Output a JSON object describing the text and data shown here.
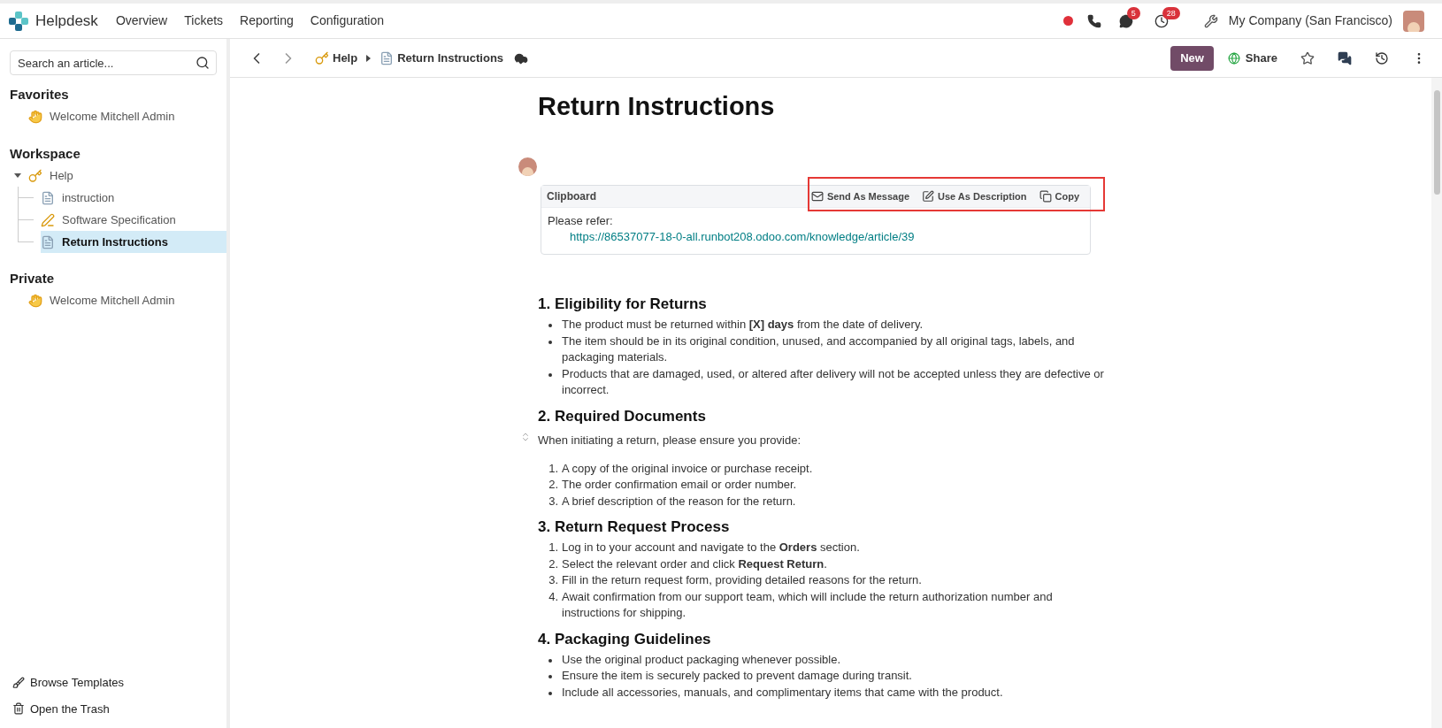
{
  "topbar": {
    "app_name": "Helpdesk",
    "menu": [
      "Overview",
      "Tickets",
      "Reporting",
      "Configuration"
    ],
    "chat_count": "5",
    "activity_count": "28",
    "company": "My Company (San Francisco)"
  },
  "sidebar": {
    "search": {
      "placeholder": "Search an article..."
    },
    "sections": [
      {
        "title": "Favorites",
        "items": [
          {
            "label": "Welcome Mitchell Admin",
            "kind": "wave",
            "selected": false
          }
        ]
      },
      {
        "title": "Workspace",
        "items": [
          {
            "label": "Help",
            "kind": "key",
            "selected": false,
            "expanded": true,
            "children": [
              {
                "label": "instruction",
                "kind": "page",
                "selected": false
              },
              {
                "label": "Software Specification",
                "kind": "writing",
                "selected": false
              },
              {
                "label": "Return Instructions",
                "kind": "page",
                "selected": true
              }
            ]
          }
        ]
      },
      {
        "title": "Private",
        "items": [
          {
            "label": "Welcome Mitchell Admin",
            "kind": "wave",
            "selected": false
          }
        ]
      }
    ],
    "footer": [
      {
        "label": "Browse Templates",
        "kind": "brush"
      },
      {
        "label": "Open the Trash",
        "kind": "trash"
      }
    ]
  },
  "toolbar": {
    "breadcrumb": [
      {
        "label": "Help",
        "kind": "key"
      },
      {
        "label": "Return Instructions",
        "kind": "page"
      }
    ],
    "new_button": "New",
    "share_button": "Share",
    "favorite": false
  },
  "article": {
    "title": "Return Instructions",
    "clipboard": {
      "title": "Clipboard",
      "highlighted": true,
      "actions": [
        {
          "label": "Send As Message",
          "kind": "message"
        },
        {
          "label": "Use As Description",
          "kind": "description"
        },
        {
          "label": "Copy",
          "kind": "copy"
        }
      ],
      "text": "Please refer:",
      "link": "https://86537077-18-0-all.runbot208.odoo.com/knowledge/article/39"
    },
    "sections": [
      {
        "heading": "1. Eligibility for Returns",
        "blocks": [
          {
            "kind": "bullets",
            "items": [
              {
                "text": "The product must be returned within **[X] days** from the date of delivery."
              },
              {
                "text": "The item should be in its original condition, unused, and accompanied by all original tags, labels, and packaging materials."
              },
              {
                "text": "Products that are damaged, used, or altered after delivery will not be accepted unless they are defective or incorrect."
              }
            ]
          }
        ]
      },
      {
        "heading": "2. Required Documents",
        "blocks": [
          {
            "kind": "paragraph",
            "text": "When initiating a return, please ensure you provide:"
          },
          {
            "kind": "numbered",
            "items": [
              {
                "number": "1.",
                "text": "A copy of the original invoice or purchase receipt."
              },
              {
                "number": "2.",
                "text": "The order confirmation email or order number."
              },
              {
                "number": "3.",
                "text": "A brief description of the reason for the return."
              }
            ]
          }
        ]
      },
      {
        "heading": "3. Return Request Process",
        "blocks": [
          {
            "kind": "numbered",
            "items": [
              {
                "number": "1.",
                "text": "Log in to your account and navigate to the **Orders** section."
              },
              {
                "number": "2.",
                "text": "Select the relevant order and click **Request Return**."
              },
              {
                "number": "3.",
                "text": "Fill in the return request form, providing detailed reasons for the return."
              },
              {
                "number": "4.",
                "text": "Await confirmation from our support team, which will include the return authorization number and instructions for shipping."
              }
            ]
          }
        ]
      },
      {
        "heading": "4. Packaging Guidelines",
        "blocks": [
          {
            "kind": "bullets",
            "items": [
              {
                "text": "Use the original product packaging whenever possible."
              },
              {
                "text": "Ensure the item is securely packed to prevent damage during transit."
              },
              {
                "text": "Include all accessories, manuals, and complimentary items that came with the product."
              }
            ]
          }
        ]
      }
    ]
  }
}
